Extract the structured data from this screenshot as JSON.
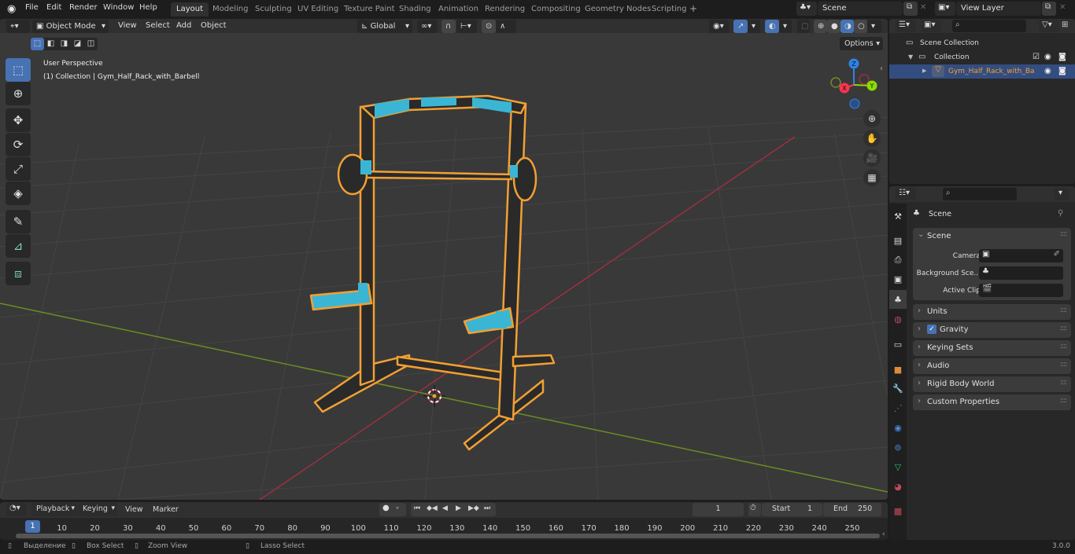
{
  "topbar": {
    "menus": [
      "File",
      "Edit",
      "Render",
      "Window",
      "Help"
    ],
    "workspaces": [
      "Layout",
      "Modeling",
      "Sculpting",
      "UV Editing",
      "Texture Paint",
      "Shading",
      "Animation",
      "Rendering",
      "Compositing",
      "Geometry Nodes",
      "Scripting"
    ],
    "active_workspace": "Layout",
    "add_workspace": "+",
    "scene_name": "Scene",
    "view_layer_name": "View Layer"
  },
  "viewport": {
    "mode": "Object Mode",
    "menus": [
      "View",
      "Select",
      "Add",
      "Object"
    ],
    "transform_orientation": "Global",
    "options_label": "Options",
    "overlay_title": "User Perspective",
    "overlay_subtitle": "(1) Collection | Gym_Half_Rack_with_Barbell",
    "gizmo_axes": {
      "x": "X",
      "y": "Y",
      "z": "Z"
    },
    "tools": [
      "tweak",
      "cursor",
      "move",
      "rotate",
      "scale",
      "transform",
      "annotate",
      "measure",
      "add-cube"
    ]
  },
  "outliner": {
    "search_placeholder": "",
    "items": [
      {
        "label": "Scene Collection",
        "level": 0
      },
      {
        "label": "Collection",
        "level": 1
      },
      {
        "label": "Gym_Half_Rack_with_Ba",
        "level": 2,
        "selected": true
      }
    ]
  },
  "properties": {
    "context_title": "Scene",
    "scene_panel": {
      "title": "Scene",
      "fields": [
        {
          "label": "Camera",
          "value": ""
        },
        {
          "label": "Background Sce...",
          "value": ""
        },
        {
          "label": "Active Clip",
          "value": ""
        }
      ]
    },
    "panels": [
      {
        "label": "Units",
        "checkbox": false
      },
      {
        "label": "Gravity",
        "checkbox": true
      },
      {
        "label": "Keying Sets",
        "checkbox": false
      },
      {
        "label": "Audio",
        "checkbox": false
      },
      {
        "label": "Rigid Body World",
        "checkbox": false
      },
      {
        "label": "Custom Properties",
        "checkbox": false
      }
    ]
  },
  "timeline": {
    "menus": [
      "Playback",
      "Keying",
      "View",
      "Marker"
    ],
    "current_frame": "1",
    "start_label": "Start",
    "start_value": "1",
    "end_label": "End",
    "end_value": "250",
    "ticks": [
      "1",
      "10",
      "20",
      "30",
      "40",
      "50",
      "60",
      "70",
      "80",
      "90",
      "100",
      "110",
      "120",
      "130",
      "140",
      "150",
      "160",
      "170",
      "180",
      "190",
      "200",
      "210",
      "220",
      "230",
      "240",
      "250"
    ]
  },
  "statusbar": {
    "items": [
      "Выделение",
      "Box Select",
      "Zoom View",
      "Lasso Select"
    ],
    "version": "3.0.0"
  },
  "colors": {
    "accent": "#4772b3",
    "selection_outline": "#f2a033",
    "axis_x": "#ff3352",
    "axis_y": "#8bdc00",
    "axis_z": "#2f83e8",
    "rack_teal": "#3ab6d4"
  }
}
